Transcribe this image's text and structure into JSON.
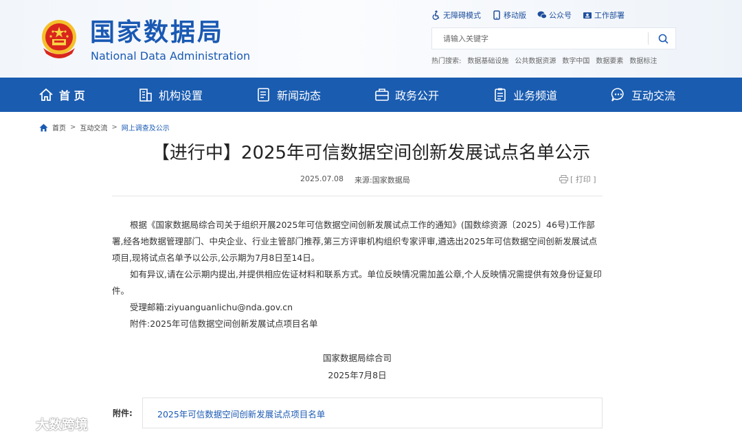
{
  "header": {
    "title_cn": "国家数据局",
    "title_en": "National Data Administration",
    "top_links": [
      {
        "label": "无障碍模式",
        "icon": "accessibility-icon"
      },
      {
        "label": "移动版",
        "icon": "mobile-icon"
      },
      {
        "label": "公众号",
        "icon": "wechat-icon"
      },
      {
        "label": "工作部署",
        "icon": "work-icon"
      }
    ],
    "search_placeholder": "请输入关键字",
    "hot_label": "热门搜索:",
    "hot_words": [
      "数据基础设施",
      "公共数据资源",
      "数字中国",
      "数据要素",
      "数据标注"
    ]
  },
  "nav": {
    "items": [
      {
        "label": "首 页",
        "icon": "home-icon"
      },
      {
        "label": "机构设置",
        "icon": "building-icon"
      },
      {
        "label": "新闻动态",
        "icon": "news-icon"
      },
      {
        "label": "政务公开",
        "icon": "government-icon"
      },
      {
        "label": "业务频道",
        "icon": "clipboard-icon"
      },
      {
        "label": "互动交流",
        "icon": "chat-icon"
      }
    ]
  },
  "breadcrumb": {
    "items": [
      "首页",
      "互动交流",
      "网上调查及公示"
    ],
    "sep": ">"
  },
  "article": {
    "title": "【进行中】2025年可信数据空间创新发展试点名单公示",
    "date": "2025.07.08",
    "source": "来源:国家数据局",
    "print_label": "[ 打印 ]",
    "paragraphs": [
      "根据《国家数据局综合司关于组织开展2025年可信数据空间创新发展试点工作的通知》(国数综资源〔2025〕46号)工作部署,经各地数据管理部门、中央企业、行业主管部门推荐,第三方评审机构组织专家评审,遴选出2025年可信数据空间创新发展试点项目,现将试点名单予以公示,公示期为7月8日至14日。",
      "如有异议,请在公示期内提出,并提供相应佐证材料和联系方式。单位反映情况需加盖公章,个人反映情况需提供有效身份证复印件。",
      "受理邮箱:ziyuanguanlichu@nda.gov.cn",
      "附件:2025年可信数据空间创新发展试点项目名单"
    ],
    "signer": "国家数据局综合司",
    "sign_date": "2025年7月8日",
    "attachment_label": "附件:",
    "attachment_link": "2025年可信数据空间创新发展试点项目名单"
  },
  "watermark": "大数跨境",
  "colors": {
    "primary": "#1a5cb0",
    "link": "#1a59b3"
  }
}
